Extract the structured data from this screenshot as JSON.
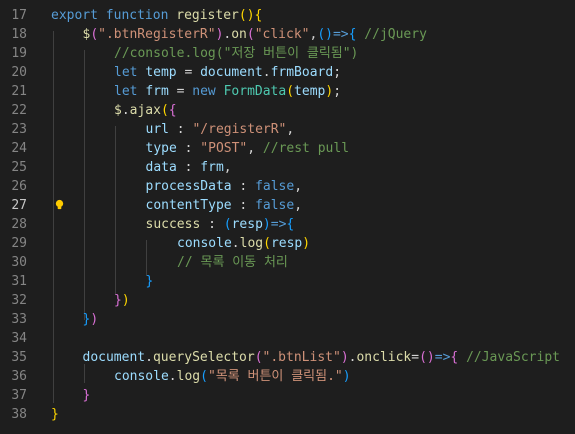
{
  "editor": {
    "language": "javascript",
    "theme_colors": {
      "background": "#1e1e1e",
      "line_number": "#858585",
      "keyword": "#569cd6",
      "function": "#dcdcaa",
      "string": "#ce9178",
      "comment": "#6a9955",
      "variable": "#9cdcfe",
      "class": "#4ec9b0",
      "bracket_1": "#ffd700",
      "bracket_2": "#da70d6",
      "bracket_3": "#179fff"
    },
    "active_line": 27,
    "lightbulb_line": 27,
    "lines": [
      {
        "number": 17,
        "indent": 0,
        "tokens": [
          [
            "kw",
            "export"
          ],
          [
            "op",
            " "
          ],
          [
            "kw",
            "function"
          ],
          [
            "op",
            " "
          ],
          [
            "fn",
            "register"
          ],
          [
            "b1",
            "()"
          ],
          [
            "b1",
            "{"
          ]
        ]
      },
      {
        "number": 18,
        "indent": 1,
        "tokens": [
          [
            "fn",
            "$"
          ],
          [
            "b2",
            "("
          ],
          [
            "str",
            "\".btnRegisterR\""
          ],
          [
            "b2",
            ")"
          ],
          [
            "op",
            "."
          ],
          [
            "fn",
            "on"
          ],
          [
            "b2",
            "("
          ],
          [
            "str",
            "\"click\""
          ],
          [
            "op",
            ","
          ],
          [
            "b3",
            "()"
          ],
          [
            "kw",
            "=>"
          ],
          [
            "b3",
            "{"
          ],
          [
            "op",
            " "
          ],
          [
            "cm",
            "//jQuery"
          ]
        ]
      },
      {
        "number": 19,
        "indent": 2,
        "tokens": [
          [
            "cm",
            "//console.log(\"저장 버튼이 클릭됨\")"
          ]
        ]
      },
      {
        "number": 20,
        "indent": 2,
        "tokens": [
          [
            "kw",
            "let"
          ],
          [
            "op",
            " "
          ],
          [
            "var",
            "temp"
          ],
          [
            "op",
            " = "
          ],
          [
            "var",
            "document"
          ],
          [
            "op",
            "."
          ],
          [
            "var",
            "frmBoard"
          ],
          [
            "op",
            ";"
          ]
        ]
      },
      {
        "number": 21,
        "indent": 2,
        "tokens": [
          [
            "kw",
            "let"
          ],
          [
            "op",
            " "
          ],
          [
            "var",
            "frm"
          ],
          [
            "op",
            " = "
          ],
          [
            "kw",
            "new"
          ],
          [
            "op",
            " "
          ],
          [
            "cls",
            "FormData"
          ],
          [
            "b1",
            "("
          ],
          [
            "var",
            "temp"
          ],
          [
            "b1",
            ")"
          ],
          [
            "op",
            ";"
          ]
        ]
      },
      {
        "number": 22,
        "indent": 2,
        "tokens": [
          [
            "fn",
            "$"
          ],
          [
            "op",
            "."
          ],
          [
            "fn",
            "ajax"
          ],
          [
            "b1",
            "("
          ],
          [
            "b2",
            "{"
          ]
        ]
      },
      {
        "number": 23,
        "indent": 3,
        "tokens": [
          [
            "var",
            "url"
          ],
          [
            "op",
            " : "
          ],
          [
            "str",
            "\"/registerR\""
          ],
          [
            "op",
            ","
          ]
        ]
      },
      {
        "number": 24,
        "indent": 3,
        "tokens": [
          [
            "var",
            "type"
          ],
          [
            "op",
            " : "
          ],
          [
            "str",
            "\"POST\""
          ],
          [
            "op",
            ", "
          ],
          [
            "cm",
            "//rest pull"
          ]
        ]
      },
      {
        "number": 25,
        "indent": 3,
        "tokens": [
          [
            "var",
            "data"
          ],
          [
            "op",
            " : "
          ],
          [
            "var",
            "frm"
          ],
          [
            "op",
            ","
          ]
        ]
      },
      {
        "number": 26,
        "indent": 3,
        "tokens": [
          [
            "var",
            "processData"
          ],
          [
            "op",
            " : "
          ],
          [
            "kw",
            "false"
          ],
          [
            "op",
            ","
          ]
        ]
      },
      {
        "number": 27,
        "indent": 3,
        "tokens": [
          [
            "var",
            "contentType"
          ],
          [
            "op",
            " : "
          ],
          [
            "kw",
            "false"
          ],
          [
            "op",
            ","
          ]
        ]
      },
      {
        "number": 28,
        "indent": 3,
        "tokens": [
          [
            "fn",
            "success"
          ],
          [
            "op",
            " : "
          ],
          [
            "b3",
            "("
          ],
          [
            "var",
            "resp"
          ],
          [
            "b3",
            ")"
          ],
          [
            "kw",
            "=>"
          ],
          [
            "b3",
            "{"
          ]
        ]
      },
      {
        "number": 29,
        "indent": 4,
        "tokens": [
          [
            "var",
            "console"
          ],
          [
            "op",
            "."
          ],
          [
            "fn",
            "log"
          ],
          [
            "b1",
            "("
          ],
          [
            "var",
            "resp"
          ],
          [
            "b1",
            ")"
          ]
        ]
      },
      {
        "number": 30,
        "indent": 4,
        "tokens": [
          [
            "cm",
            "// 목록 이동 처리"
          ]
        ]
      },
      {
        "number": 31,
        "indent": 3,
        "tokens": [
          [
            "b3",
            "}"
          ]
        ]
      },
      {
        "number": 32,
        "indent": 2,
        "tokens": [
          [
            "b2",
            "}"
          ],
          [
            "b1",
            ")"
          ]
        ]
      },
      {
        "number": 33,
        "indent": 1,
        "tokens": [
          [
            "b3",
            "}"
          ],
          [
            "b2",
            ")"
          ]
        ]
      },
      {
        "number": 34,
        "indent": 0,
        "tokens": []
      },
      {
        "number": 35,
        "indent": 1,
        "tokens": [
          [
            "var",
            "document"
          ],
          [
            "op",
            "."
          ],
          [
            "fn",
            "querySelector"
          ],
          [
            "b2",
            "("
          ],
          [
            "str",
            "\".btnList\""
          ],
          [
            "b2",
            ")"
          ],
          [
            "op",
            "."
          ],
          [
            "fn",
            "onclick"
          ],
          [
            "op",
            "="
          ],
          [
            "b2",
            "()"
          ],
          [
            "kw",
            "=>"
          ],
          [
            "b2",
            "{"
          ],
          [
            "op",
            " "
          ],
          [
            "cm",
            "//JavaScript"
          ]
        ]
      },
      {
        "number": 36,
        "indent": 2,
        "tokens": [
          [
            "var",
            "console"
          ],
          [
            "op",
            "."
          ],
          [
            "fn",
            "log"
          ],
          [
            "b3",
            "("
          ],
          [
            "str",
            "\"목록 버튼이 클릭됨.\""
          ],
          [
            "b3",
            ")"
          ]
        ]
      },
      {
        "number": 37,
        "indent": 1,
        "tokens": [
          [
            "b2",
            "}"
          ]
        ]
      },
      {
        "number": 38,
        "indent": 0,
        "tokens": [
          [
            "b1",
            "}"
          ]
        ]
      }
    ]
  }
}
